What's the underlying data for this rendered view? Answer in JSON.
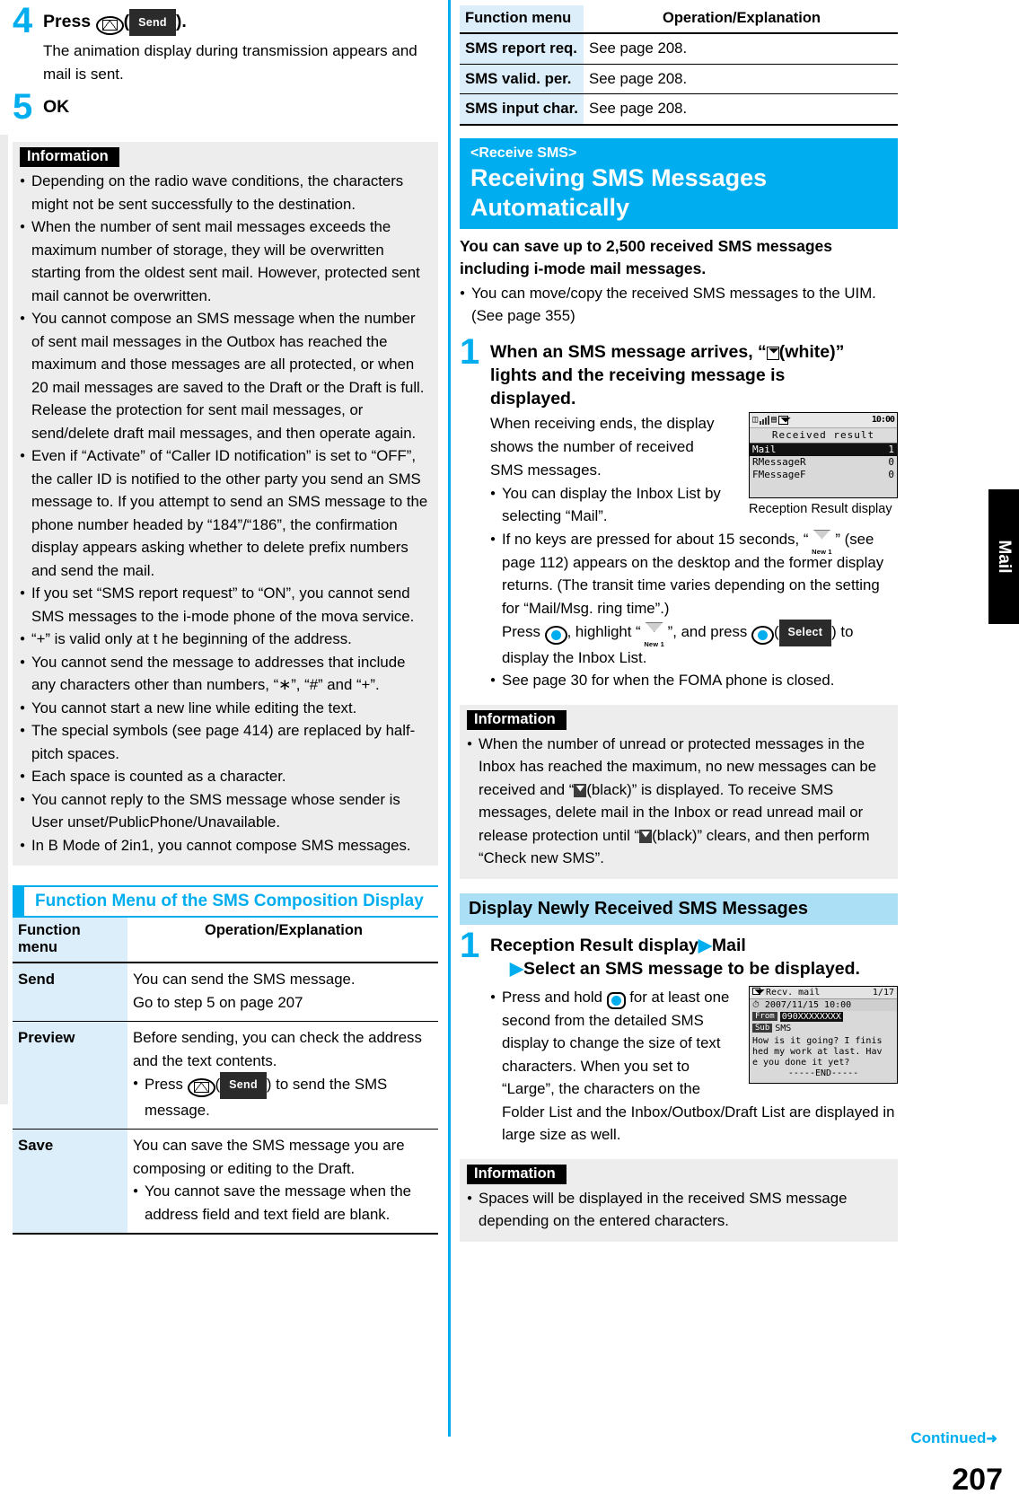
{
  "page": {
    "number": "207",
    "side_tab": "Mail",
    "continued": "Continued"
  },
  "left": {
    "steps": [
      {
        "num": "4",
        "title_pre": "Press ",
        "title_key": "envelope-key",
        "title_soft": "Send",
        "title_post": ").",
        "desc": "The animation display during transmission appears and mail is sent."
      },
      {
        "num": "5",
        "title_pre": "OK",
        "desc": ""
      }
    ],
    "information": {
      "label": "Information",
      "items": [
        "Depending on the radio wave conditions, the characters might not be sent successfully to the destination.",
        "When the number of sent mail messages exceeds the maximum number of storage, they will be overwritten starting from the oldest sent mail. However, protected sent mail cannot be overwritten.",
        "You cannot compose an SMS message when the number of sent mail messages in the Outbox has reached the maximum and those messages are all protected, or when 20 mail messages are saved to the Draft or the Draft is full. Release the protection for sent mail messages, or send/delete draft mail messages, and then operate again.",
        "Even if “Activate” of “Caller ID notification” is set to “OFF”, the caller ID is notified to the other party you send an SMS message to. If you attempt to send an SMS message to the phone number headed by “184”/“186”, the confirmation display appears asking whether to delete prefix numbers and send the mail.",
        "If you set “SMS report request” to “ON”, you cannot send SMS messages to the i-mode phone of the mova service.",
        "“+” is valid only at t he beginning of the address.",
        "You cannot send the message to addresses that include any characters other than numbers, “∗”, “#” and “+”.",
        "You cannot start a new line while editing the text.",
        "The special symbols (see page 414) are replaced by half-pitch spaces.",
        "Each space is counted as a character.",
        "You cannot reply to the SMS message whose sender is User unset/PublicPhone/Unavailable.",
        "In B Mode of 2in1, you cannot compose SMS messages."
      ]
    },
    "section_heading": "Function Menu of the SMS Composition Display",
    "table": {
      "headers": [
        "Function menu",
        "Operation/Explanation"
      ],
      "rows": [
        {
          "menu": "Send",
          "lines": [
            "You can send the SMS message.",
            "Go to step 5 on page 207"
          ],
          "bullets": []
        },
        {
          "menu": "Preview",
          "lines": [
            "Before sending, you can check the address and the text contents."
          ],
          "bullets": [
            "Press (  ) to send the SMS message."
          ],
          "bullet_key": "envelope-key",
          "bullet_soft": "Send"
        },
        {
          "menu": "Save",
          "lines": [
            "You can save the SMS message you are composing or editing to the Draft."
          ],
          "bullets": [
            "You cannot save the message when the address field and text field are blank."
          ]
        }
      ]
    }
  },
  "right": {
    "top_table": {
      "headers": [
        "Function menu",
        "Operation/Explanation"
      ],
      "rows": [
        {
          "menu": "SMS report req.",
          "text": "See page 208."
        },
        {
          "menu": "SMS valid. per.",
          "text": "See page 208."
        },
        {
          "menu": "SMS input char.",
          "text": "See page 208."
        }
      ]
    },
    "title_block": {
      "kicker": "<Receive SMS>",
      "main_line1": "Receiving SMS Messages",
      "main_line2": "Automatically"
    },
    "lead_line1": "You can save up to 2,500 received SMS messages",
    "lead_line2": "including i-mode mail messages.",
    "lead_bullets": [
      "You can move/copy the received SMS messages to the UIM. (See page 355)"
    ],
    "step1": {
      "num": "1",
      "title_a": "When an SMS message arrives, “",
      "title_b": "(white)”",
      "title_c": "lights and the receiving message is",
      "title_d": "displayed.",
      "body_lines": [
        "When receiving ends, the display",
        "shows the number of received",
        "SMS messages."
      ],
      "bullets": [
        "You can display the Inbox List by selecting “Mail”.",
        "If no keys are pressed for about 15 seconds, “  ” (see page 112) appears on the desktop and the former display returns. (The transit time varies depending on the setting for “Mail/Msg. ring time”.)",
        "See page 30 for when the FOMA phone is closed."
      ],
      "press_line_a": "Press ",
      "press_line_b": ", highlight “",
      "press_line_c": "”, and press ",
      "press_soft": "Select",
      "press_line_d": ") to",
      "press_line_e": "display the Inbox List."
    },
    "shot1": {
      "alt": "Reception Result display",
      "clock": "10:00",
      "title": "Received result",
      "rows": [
        {
          "label": "Mail",
          "count": "1",
          "selected": true,
          "prefix": ""
        },
        {
          "label": "MessageR",
          "count": "0",
          "selected": false,
          "prefix": "R"
        },
        {
          "label": "MessageF",
          "count": "0",
          "selected": false,
          "prefix": "F"
        }
      ],
      "caption": "Reception Result display"
    },
    "information": {
      "label": "Information",
      "items": [
        "When the number of unread or protected messages in the Inbox has reached the maximum, no new messages can be received and “ (black)” is displayed. To receive SMS messages, delete mail in the Inbox or read unread mail or release protection until “ (black)” clears, and then perform “Check new SMS”."
      ]
    },
    "sub_bar": "Display Newly Received SMS Messages",
    "step2": {
      "num": "1",
      "title_line1_a": "Reception Result display",
      "title_line1_b": "Mail",
      "title_line2": "Select an SMS message to be displayed.",
      "bullets": [
        "Press and hold  for at least one second from the detailed SMS display to change the size of text characters. When you set to “Large”, the characters on the Folder List and the Inbox/Outbox/Draft List are displayed in large size as well."
      ]
    },
    "shot2": {
      "header_left": "Recv. mail",
      "header_right": "1/17",
      "date": "2007/11/15 10:00",
      "from_label": "From",
      "from_value": "090XXXXXXXX",
      "sub_label": "Sub",
      "sub_value": "SMS",
      "body": [
        "How is it going? I finis",
        "hed my work at last. Hav",
        "e you done it yet?",
        "-----END-----"
      ]
    },
    "information2": {
      "label": "Information",
      "items": [
        "Spaces will be displayed in the received SMS message depending on the entered characters."
      ]
    }
  }
}
